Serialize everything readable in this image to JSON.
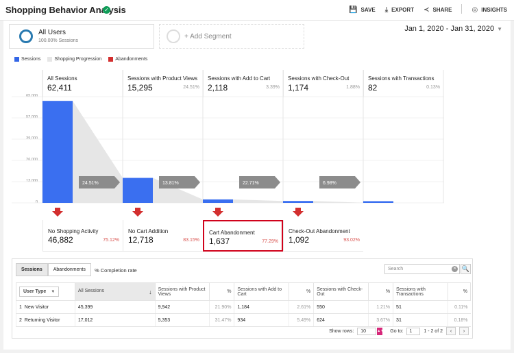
{
  "header": {
    "title": "Shopping Behavior Analysis",
    "save": "SAVE",
    "export": "EXPORT",
    "share": "SHARE",
    "insights": "INSIGHTS"
  },
  "segments": {
    "segment1_name": "All Users",
    "segment1_sub": "100.00% Sessions",
    "add_segment": "+ Add Segment"
  },
  "date_range": "Jan 1, 2020 - Jan 31, 2020",
  "legend": [
    {
      "label": "Sessions",
      "color": "#3366e6"
    },
    {
      "label": "Shopping Progression",
      "color": "#e6e6e6"
    },
    {
      "label": "Abandonments",
      "color": "#d32f2f"
    }
  ],
  "colors": {
    "bar": "#3a6ff0",
    "arrow": "#d32f2f",
    "progression": "#e6e6e6",
    "tag": "#8c8c8c"
  },
  "chart_data": {
    "type": "bar",
    "categories": [
      "All Sessions",
      "Sessions with Product Views",
      "Sessions with Add to Cart",
      "Sessions with Check-Out",
      "Sessions with Transactions"
    ],
    "values": [
      62411,
      15295,
      2118,
      1174,
      82
    ],
    "ylim": [
      0,
      65000
    ],
    "yticks": [
      "65,000",
      "52,000",
      "39,000",
      "26,000",
      "13,000",
      "0"
    ],
    "stage_pct": [
      "",
      "24.51%",
      "3.39%",
      "1.88%",
      "0.13%"
    ],
    "progression_tags": [
      "24.51%",
      "13.81%",
      "22.71%",
      "6.98%"
    ],
    "abandonments": [
      {
        "label": "No Shopping Activity",
        "value": "46,882",
        "pct": "75.12%"
      },
      {
        "label": "No Cart Addition",
        "value": "12,718",
        "pct": "83.15%"
      },
      {
        "label": "Cart Abandonment",
        "value": "1,637",
        "pct": "77.29%"
      },
      {
        "label": "Check-Out Abandonment",
        "value": "1,092",
        "pct": "93.02%"
      }
    ]
  },
  "stages": [
    {
      "label": "All Sessions",
      "value": "62,411",
      "pct": ""
    },
    {
      "label": "Sessions with Product Views",
      "value": "15,295",
      "pct": "24.51%"
    },
    {
      "label": "Sessions with Add to Cart",
      "value": "2,118",
      "pct": "3.39%"
    },
    {
      "label": "Sessions with Check-Out",
      "value": "1,174",
      "pct": "1.88%"
    },
    {
      "label": "Sessions with Transactions",
      "value": "82",
      "pct": "0.13%"
    }
  ],
  "table": {
    "tab_sessions": "Sessions",
    "tab_abandonments": "Abandonments",
    "completion_rate": "% Completion rate",
    "search_placeholder": "Search",
    "dimension_label": "User Type",
    "columns": [
      "All Sessions",
      "Sessions with Product Views",
      "%",
      "Sessions with Add to Cart",
      "%",
      "Sessions with Check-Out",
      "%",
      "Sessions with Transactions",
      "%"
    ],
    "rows": [
      {
        "idx": "1",
        "name": "New Visitor",
        "cells": [
          "45,399",
          "9,942",
          "21.90%",
          "1,184",
          "2.61%",
          "550",
          "1.21%",
          "51",
          "0.11%"
        ]
      },
      {
        "idx": "2",
        "name": "Returning Visitor",
        "cells": [
          "17,012",
          "5,353",
          "31.47%",
          "934",
          "5.49%",
          "624",
          "3.67%",
          "31",
          "0.18%"
        ]
      }
    ],
    "show_rows_label": "Show rows:",
    "show_rows_value": "10",
    "goto_label": "Go to:",
    "goto_value": "1",
    "range_text": "1 - 2 of 2"
  }
}
